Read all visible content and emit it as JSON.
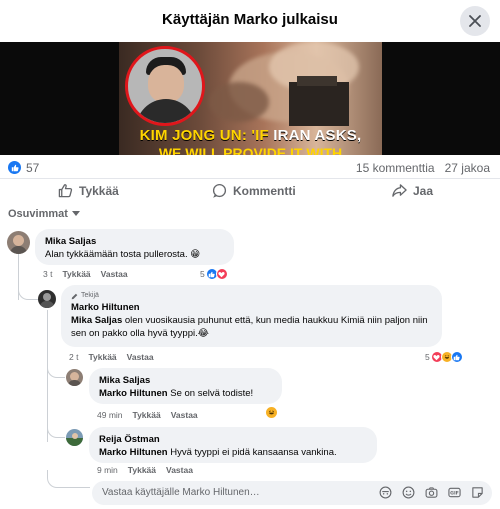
{
  "header": {
    "title": "Käyttäjän Marko julkaisu"
  },
  "media": {
    "caption_highlight": "KIM JONG UN: 'IF ",
    "caption_white": "IRAN ASKS,",
    "caption_line2": "WE WILL PROVIDE IT WITH"
  },
  "stats": {
    "likes": "57",
    "comments": "15 kommenttia",
    "shares": "27 jakoa"
  },
  "actions": {
    "like": "Tykkää",
    "comment": "Kommentti",
    "share": "Jaa"
  },
  "sort": {
    "label": "Osuvimmat"
  },
  "comments": [
    {
      "name": "Mika Saljas",
      "text": "Alan tykkäämään tosta pullerosta. 😁",
      "time": "3 t",
      "like": "Tykkää",
      "reply": "Vastaa",
      "reactions": "5"
    },
    {
      "badge": "Tekijä",
      "name": "Marko Hiltunen",
      "mention": "Mika Saljas",
      "text": " olen vuosikausia puhunut että, kun media haukkuu Kimiä niin paljon niin sen on pakko olla hyvä tyyppi.😂",
      "time": "2 t",
      "like": "Tykkää",
      "reply": "Vastaa",
      "reactions": "5"
    },
    {
      "name": "Mika Saljas",
      "mention": "Marko Hiltunen",
      "text": " Se on selvä todiste!",
      "time": "49 min",
      "like": "Tykkää",
      "reply": "Vastaa"
    },
    {
      "name": "Reija Östman",
      "mention": "Marko Hiltunen",
      "text": " Hyvä tyyppi ei pidä kansaansa vankina.",
      "time": "9 min",
      "like": "Tykkää",
      "reply": "Vastaa"
    }
  ],
  "reply_box": {
    "placeholder": "Vastaa käyttäjälle Marko Hiltunen…"
  },
  "colors": {
    "accent": "#1877f2",
    "love": "#f33e58",
    "haha": "#f7b125",
    "bubble": "#f0f2f5"
  }
}
